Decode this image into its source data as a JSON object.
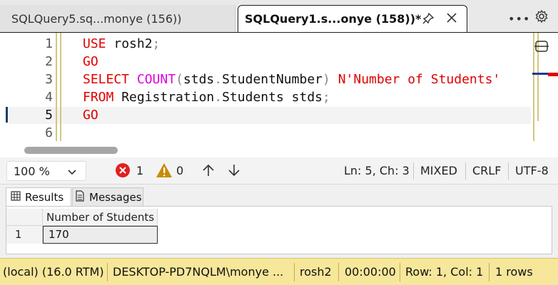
{
  "tabs": [
    {
      "label": "SQLQuery5.sq...monye (156))",
      "active": false
    },
    {
      "label": "SQLQuery1.s...onye (158))*",
      "active": true
    }
  ],
  "toolbar": {
    "more_icon": "ellipsis-icon",
    "settings_icon": "gear-icon"
  },
  "editor": {
    "line_numbers": [
      "1",
      "2",
      "3",
      "4",
      "5",
      "6"
    ],
    "current_line": "5",
    "lines": {
      "l1": {
        "kw": "USE",
        "rest": " rosh2",
        "semi": ";"
      },
      "l2": {
        "kw": "GO"
      },
      "l3": {
        "kw": "SELECT",
        "fn": "COUNT",
        "open": "(",
        "ident1": "stds",
        "dot": ".",
        "ident2": "StudentNumber",
        "close": ")",
        "str": "N'Number of Students'"
      },
      "l4": {
        "kw": "FROM",
        "ident1": "Registration",
        "dot1": ".",
        "ident2": "Students",
        "ident3": "stds",
        "semi": ";"
      },
      "l5": {
        "kw": "GO"
      }
    }
  },
  "editor_status": {
    "zoom": "100 %",
    "errors": "1",
    "warnings": "0",
    "position": "Ln: 5, Ch: 3",
    "whitespace": "MIXED",
    "line_ending": "CRLF",
    "encoding": "UTF-8"
  },
  "results_tabs": {
    "results": "Results",
    "messages": "Messages"
  },
  "results_grid": {
    "columns": [
      "Number of Students"
    ],
    "rows": [
      {
        "num": "1",
        "values": [
          "170"
        ]
      }
    ]
  },
  "statusbar": {
    "server": "(local) (16.0 RTM)",
    "user": "DESKTOP-PD7NQLM\\monye ...",
    "database": "rosh2",
    "elapsed": "00:00:00",
    "rowcol": "Row: 1, Col: 1",
    "rows": "1 rows"
  },
  "colors": {
    "keyword": "#e00000",
    "function": "#e000e0",
    "status_bar": "#f6e79a",
    "error": "#e02020",
    "warning": "#c98a00"
  }
}
